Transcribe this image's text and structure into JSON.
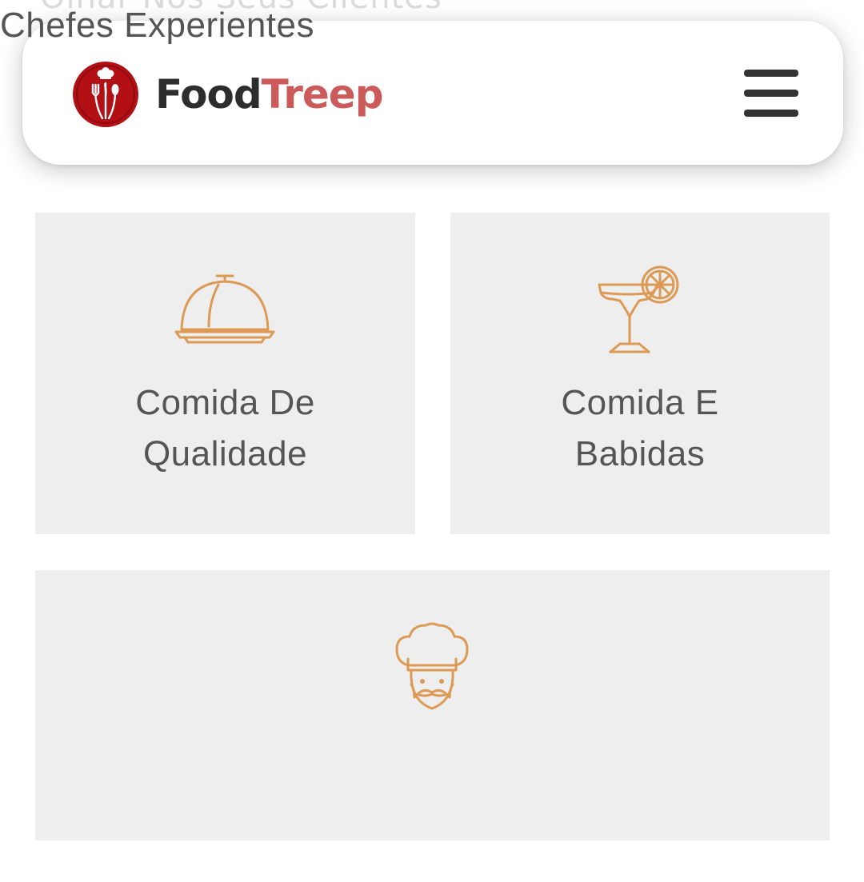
{
  "peek_text": "Olhar Nós Seus Clientes",
  "header": {
    "brand_part1": "Food",
    "brand_part2": "Treep",
    "logo_icon": "chef-hat-cutlery-logo-icon",
    "menu_icon": "hamburger-menu-icon"
  },
  "features": [
    {
      "icon": "cloche-icon",
      "title_line1": "Comida De",
      "title_line2": "Qualidade"
    },
    {
      "icon": "cocktail-icon",
      "title_line1": "Comida E",
      "title_line2": "Babidas"
    },
    {
      "icon": "chef-icon",
      "title": "Chefes Experientes"
    }
  ],
  "colors": {
    "brand_dark": "#2d2d2d",
    "brand_accent": "#cc5a5a",
    "logo_red": "#b31016",
    "icon_orange": "#dc9a55",
    "card_bg": "#eeeeee",
    "card_text": "#555555"
  }
}
